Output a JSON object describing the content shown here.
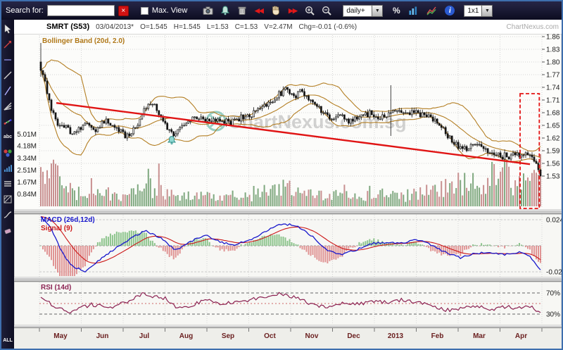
{
  "toolbar": {
    "search_label": "Search for:",
    "search_value": "",
    "max_view_label": "Max. View",
    "period_value": "daily+",
    "layout_value": "1x1",
    "glyphs": {
      "clear": "×",
      "rewind": "◀◀",
      "forward": "▶▶",
      "percent": "%",
      "info": "i",
      "dropdown": "▼"
    }
  },
  "sidebar": {
    "tools": [
      {
        "name": "pointer-tool",
        "kind": "cursor"
      },
      {
        "name": "trend-arrow-tool",
        "kind": "arrow"
      },
      {
        "name": "horizontal-line-tool",
        "kind": "hline"
      },
      {
        "name": "diagonal-line-tool",
        "kind": "diag"
      },
      {
        "name": "ray-line-tool",
        "kind": "diag2"
      },
      {
        "name": "fan-lines-tool",
        "kind": "fan"
      },
      {
        "name": "fibonacci-tool",
        "kind": "dots"
      },
      {
        "name": "text-tool",
        "kind": "abc",
        "label": "abc"
      },
      {
        "name": "color-marker-tool",
        "kind": "circles"
      },
      {
        "name": "volume-bars-tool",
        "kind": "bars"
      },
      {
        "name": "indicator-list-tool",
        "kind": "rows"
      },
      {
        "name": "pattern-fill-tool",
        "kind": "hatch"
      },
      {
        "name": "curve-tool",
        "kind": "curve"
      },
      {
        "name": "eraser-tool",
        "kind": "erase"
      }
    ],
    "all_label": "ALL"
  },
  "header": {
    "symbol": "SMRT (S53)",
    "date": "03/04/2013*",
    "open": "O=1.545",
    "high": "H=1.545",
    "low": "L=1.53",
    "close": "C=1.53",
    "volume": "V=2.47M",
    "change": "Chg=-0.01 (-0.6%)",
    "brand": "ChartNexus.com"
  },
  "watermark": "ChartNexus.com.sg",
  "chart_data": {
    "type": "candlestick",
    "symbol": "SMRT (S53)",
    "overlay_label": "Bollinger Band (20d, 2.0)",
    "price_ticks": [
      "1.86",
      "1.83",
      "1.80",
      "1.77",
      "1.74",
      "1.71",
      "1.68",
      "1.65",
      "1.62",
      "1.59",
      "1.56",
      "1.53"
    ],
    "volume_ticks": [
      "5.01M",
      "4.18M",
      "3.34M",
      "2.51M",
      "1.67M",
      "0.84M"
    ],
    "x_labels": [
      "May",
      "Jun",
      "Jul",
      "Aug",
      "Sep",
      "Oct",
      "Nov",
      "Dec",
      "2013",
      "Feb",
      "Mar",
      "Apr"
    ],
    "price_range": [
      1.53,
      1.86
    ],
    "last": {
      "open": 1.545,
      "high": 1.545,
      "low": 1.53,
      "close": 1.53
    },
    "close_anchors": [
      [
        0,
        1.795
      ],
      [
        0.008,
        1.755
      ],
      [
        0.02,
        1.69
      ],
      [
        0.035,
        1.655
      ],
      [
        0.05,
        1.645
      ],
      [
        0.07,
        1.63
      ],
      [
        0.09,
        1.652
      ],
      [
        0.11,
        1.638
      ],
      [
        0.13,
        1.664
      ],
      [
        0.15,
        1.648
      ],
      [
        0.17,
        1.625
      ],
      [
        0.19,
        1.642
      ],
      [
        0.205,
        1.69
      ],
      [
        0.225,
        1.703
      ],
      [
        0.24,
        1.672
      ],
      [
        0.255,
        1.638
      ],
      [
        0.27,
        1.628
      ],
      [
        0.285,
        1.652
      ],
      [
        0.3,
        1.664
      ],
      [
        0.32,
        1.668
      ],
      [
        0.34,
        1.654
      ],
      [
        0.36,
        1.664
      ],
      [
        0.38,
        1.658
      ],
      [
        0.4,
        1.668
      ],
      [
        0.42,
        1.674
      ],
      [
        0.44,
        1.688
      ],
      [
        0.46,
        1.703
      ],
      [
        0.475,
        1.722
      ],
      [
        0.49,
        1.733
      ],
      [
        0.505,
        1.718
      ],
      [
        0.52,
        1.728
      ],
      [
        0.535,
        1.713
      ],
      [
        0.55,
        1.698
      ],
      [
        0.565,
        1.679
      ],
      [
        0.58,
        1.664
      ],
      [
        0.6,
        1.674
      ],
      [
        0.615,
        1.658
      ],
      [
        0.63,
        1.664
      ],
      [
        0.645,
        1.673
      ],
      [
        0.66,
        1.679
      ],
      [
        0.675,
        1.668
      ],
      [
        0.69,
        1.674
      ],
      [
        0.705,
        1.684
      ],
      [
        0.72,
        1.689
      ],
      [
        0.735,
        1.679
      ],
      [
        0.75,
        1.684
      ],
      [
        0.765,
        1.674
      ],
      [
        0.78,
        1.668
      ],
      [
        0.8,
        1.653
      ],
      [
        0.815,
        1.624
      ],
      [
        0.83,
        1.604
      ],
      [
        0.845,
        1.594
      ],
      [
        0.86,
        1.6
      ],
      [
        0.875,
        1.61
      ],
      [
        0.89,
        1.594
      ],
      [
        0.905,
        1.584
      ],
      [
        0.92,
        1.579
      ],
      [
        0.935,
        1.574
      ],
      [
        0.95,
        1.584
      ],
      [
        0.965,
        1.579
      ],
      [
        0.975,
        1.589
      ],
      [
        0.985,
        1.574
      ],
      [
        0.995,
        1.548
      ],
      [
        1,
        1.53
      ]
    ],
    "volume_anchors": [
      [
        0,
        1.6
      ],
      [
        0.02,
        2.6
      ],
      [
        0.05,
        1.0
      ],
      [
        0.09,
        0.7
      ],
      [
        0.13,
        0.9
      ],
      [
        0.17,
        0.7
      ],
      [
        0.21,
        1.5
      ],
      [
        0.25,
        0.9
      ],
      [
        0.3,
        0.7
      ],
      [
        0.35,
        0.6
      ],
      [
        0.4,
        0.7
      ],
      [
        0.45,
        1.1
      ],
      [
        0.49,
        1.4
      ],
      [
        0.53,
        0.9
      ],
      [
        0.58,
        0.8
      ],
      [
        0.63,
        0.7
      ],
      [
        0.68,
        0.9
      ],
      [
        0.72,
        0.8
      ],
      [
        0.76,
        0.9
      ],
      [
        0.8,
        1.3
      ],
      [
        0.83,
        1.8
      ],
      [
        0.86,
        1.5
      ],
      [
        0.89,
        1.9
      ],
      [
        0.92,
        2.3
      ],
      [
        0.95,
        1.7
      ],
      [
        0.97,
        2.4
      ],
      [
        1,
        2.4
      ]
    ],
    "trendline": {
      "f1": 0.031,
      "p1": 1.703,
      "f2": 0.979,
      "p2": 1.558
    },
    "highlight_box": {
      "f1": 0.962,
      "f2": 0.992,
      "p_top": 1.725
    },
    "bell_marker_f": 0.262,
    "spike": {
      "f": 0.702,
      "high": 1.745,
      "low": 1.625
    },
    "macd": {
      "label": "MACD (26d,12d)",
      "signal_label": "Signal (9)",
      "axis_ticks": [
        "0.024",
        "-0.024"
      ],
      "axis_values": [
        0.024,
        -0.024
      ],
      "anchors": [
        [
          0,
          0.027
        ],
        [
          0.02,
          0.016
        ],
        [
          0.04,
          -0.004
        ],
        [
          0.06,
          -0.018
        ],
        [
          0.09,
          -0.024
        ],
        [
          0.12,
          -0.012
        ],
        [
          0.15,
          -0.002
        ],
        [
          0.18,
          0.007
        ],
        [
          0.21,
          0.014
        ],
        [
          0.24,
          0.007
        ],
        [
          0.27,
          -0.004
        ],
        [
          0.3,
          0.004
        ],
        [
          0.33,
          0.01
        ],
        [
          0.36,
          0.003
        ],
        [
          0.39,
          0.001
        ],
        [
          0.42,
          0.006
        ],
        [
          0.45,
          0.013
        ],
        [
          0.48,
          0.02
        ],
        [
          0.51,
          0.019
        ],
        [
          0.54,
          0.01
        ],
        [
          0.57,
          -0.003
        ],
        [
          0.6,
          -0.008
        ],
        [
          0.63,
          -0.004
        ],
        [
          0.66,
          0.002
        ],
        [
          0.69,
          0.003
        ],
        [
          0.72,
          0.002
        ],
        [
          0.75,
          0.006
        ],
        [
          0.78,
          0.001
        ],
        [
          0.81,
          -0.006
        ],
        [
          0.84,
          -0.011
        ],
        [
          0.87,
          -0.007
        ],
        [
          0.9,
          -0.006
        ],
        [
          0.93,
          -0.008
        ],
        [
          0.96,
          -0.006
        ],
        [
          0.98,
          -0.01
        ],
        [
          1,
          -0.022
        ]
      ]
    },
    "rsi": {
      "label": "RSI (14d)",
      "axis_ticks": [
        "70%",
        "30%"
      ],
      "levels": [
        70,
        30
      ],
      "anchors": [
        [
          0,
          62
        ],
        [
          0.03,
          42
        ],
        [
          0.06,
          34
        ],
        [
          0.1,
          48
        ],
        [
          0.14,
          43
        ],
        [
          0.18,
          55
        ],
        [
          0.205,
          70
        ],
        [
          0.225,
          63
        ],
        [
          0.25,
          60
        ],
        [
          0.275,
          40
        ],
        [
          0.3,
          47
        ],
        [
          0.33,
          56
        ],
        [
          0.36,
          49
        ],
        [
          0.39,
          52
        ],
        [
          0.42,
          57
        ],
        [
          0.45,
          63
        ],
        [
          0.48,
          68
        ],
        [
          0.51,
          62
        ],
        [
          0.54,
          50
        ],
        [
          0.57,
          42
        ],
        [
          0.6,
          50
        ],
        [
          0.63,
          48
        ],
        [
          0.66,
          54
        ],
        [
          0.69,
          52
        ],
        [
          0.72,
          57
        ],
        [
          0.75,
          53
        ],
        [
          0.78,
          47
        ],
        [
          0.81,
          37
        ],
        [
          0.84,
          40
        ],
        [
          0.87,
          46
        ],
        [
          0.9,
          39
        ],
        [
          0.93,
          44
        ],
        [
          0.96,
          41
        ],
        [
          0.98,
          44
        ],
        [
          1,
          33
        ]
      ]
    }
  },
  "colors": {
    "up_volume": "#7fa87f",
    "down_volume": "#c89090",
    "bollinger": "#b07818",
    "trend": "#e01414",
    "macd_line": "#1818cc",
    "signal_line": "#cc1818",
    "hist_pos": "#8cc48c",
    "hist_neg": "#e09494",
    "rsi_line": "#8b2252",
    "month_label": "#6b2020"
  }
}
